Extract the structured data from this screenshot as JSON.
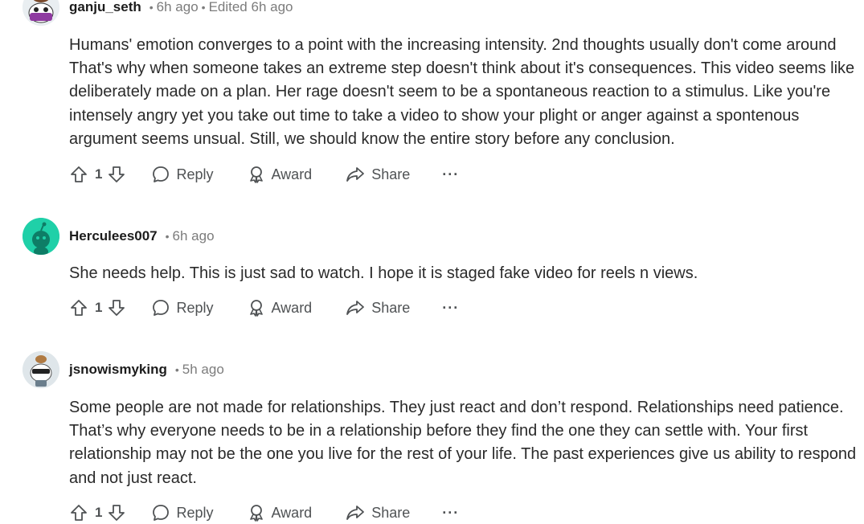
{
  "comments": [
    {
      "username": "ganju_seth",
      "time": "6h ago",
      "edited": "Edited 6h ago",
      "body": "Humans' emotion converges to a point with the increasing intensity. 2nd thoughts usually don't come around That's why when someone takes an extreme step doesn't think about it's consequences. This video seems like deliberately made on a plan. Her rage doesn't seem to be a spontaneous reaction to a stimulus. Like you're intensely angry yet you take out time to take a video to show your plight or anger against a spontenous argument seems unsual. Still, we should know the entire story before any conclusion.",
      "score": "1"
    },
    {
      "username": "Herculees007",
      "time": "6h ago",
      "body": "She needs help. This is just sad to watch. I hope it is staged fake video for reels n views.",
      "score": "1"
    },
    {
      "username": "jsnowismyking",
      "time": "5h ago",
      "body": "Some people are not made for relationships. They just react and don’t respond. Relationships need patience. That’s why everyone needs to be in a relationship before they find the one they can settle with. Your first relationship may not be the one you live for the rest of your life. The past experiences give us ability to respond and not just react.",
      "score": "1"
    }
  ],
  "actions": {
    "reply": "Reply",
    "award": "Award",
    "share": "Share",
    "more": "···"
  },
  "colors": {
    "avatar_green": "#1fd0a8",
    "meta_gray": "#7c7c7c",
    "action_gray": "#4f5254"
  },
  "icons": [
    "upvote-icon",
    "downvote-icon",
    "reply-icon",
    "award-icon",
    "share-icon",
    "more-icon"
  ]
}
